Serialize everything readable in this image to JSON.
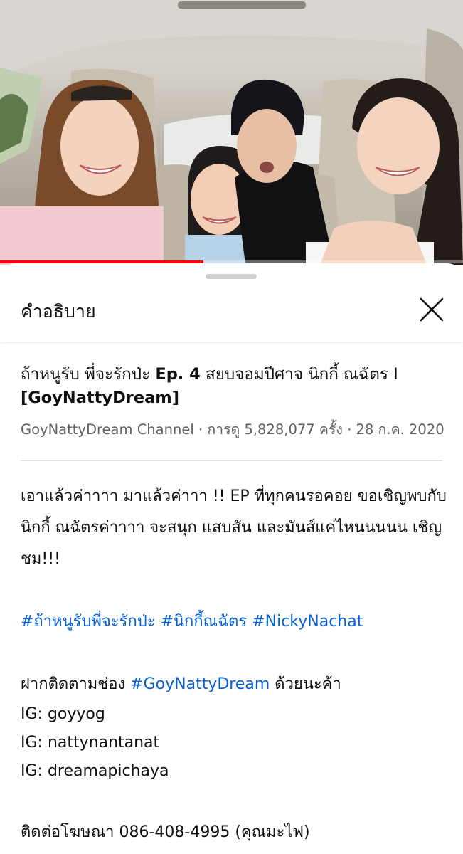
{
  "video": {
    "progress": 0.44
  },
  "sheet": {
    "title": "คำอธิบาย",
    "close_icon": "close-icon"
  },
  "details": {
    "title_plain": "ถ้าหนูรับ พี่จะรักป่ะ ",
    "title_bold": "Ep. 4",
    "title_rest": " สยบจอมปีศาจ นิกกี้ ณฉัตร I ",
    "title_bold2": "[GoyNattyDream]",
    "channel": "GoyNattyDream Channel",
    "separator": " · ",
    "views": "การดู 5,828,077 ครั้ง",
    "date": "28 ก.ค. 2020"
  },
  "description": {
    "intro": "เอาแล้วค่าาาา มาแล้วค่าาา !! EP ที่ทุกคนรอคอย ขอเชิญพบกับ นิกกี้ ณฉัตรค่าาาา จะสนุก แสบสัน และมันส์แค่ไหนนนนน เชิญชม!!!",
    "hashtags": [
      "#ถ้าหนูรับพี่จะรักป่ะ",
      "#นิกกี้ณฉัตร",
      "#NickyNachat"
    ],
    "follow_prefix": "ฝากติดตามช่อง ",
    "follow_tag": "#GoyNattyDream",
    "follow_suffix": " ด้วยนะค้า",
    "ig_lines": [
      "IG: goyyog",
      "IG: nattynantanat",
      "IG: dreamapichaya"
    ],
    "contact": "ติดต่อโฆษณา 086-408-4995 (คุณมะไฟ)"
  }
}
